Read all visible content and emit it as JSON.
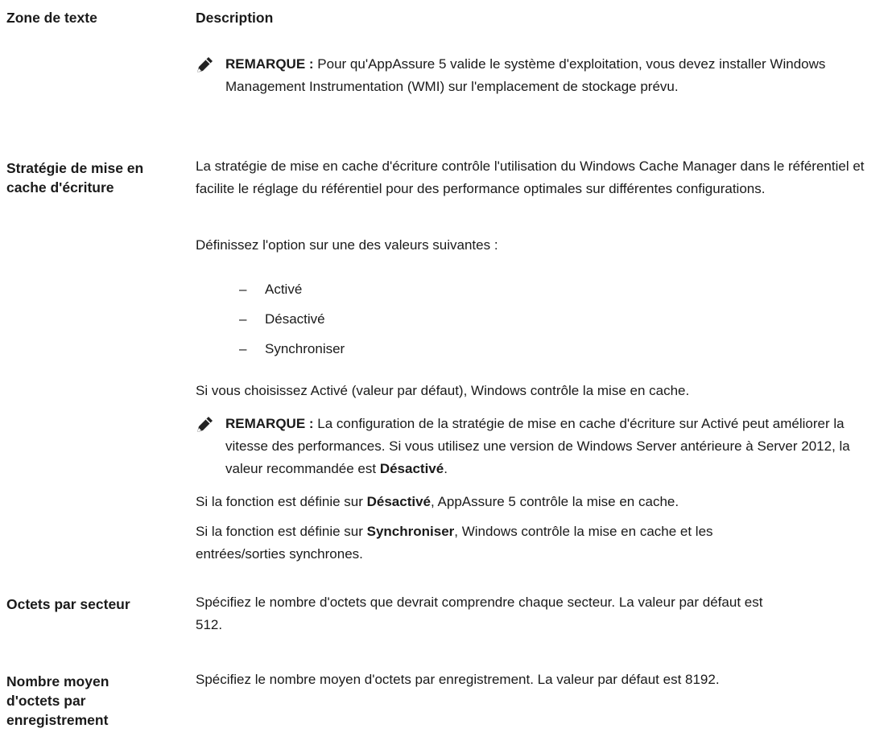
{
  "header": {
    "col1": "Zone de texte",
    "col2": "Description"
  },
  "note1": {
    "label": "REMARQUE :",
    "text": " Pour qu'AppAssure 5 valide le système d'exploitation, vous devez installer Windows Management Instrumentation (WMI) sur l'emplacement de stockage prévu."
  },
  "row1": {
    "term": "Stratégie de mise en cache d'écriture",
    "p1": "La stratégie de mise en cache d'écriture contrôle l'utilisation du Windows Cache Manager dans le référentiel et facilite le réglage du référentiel pour des performance optimales sur différentes configurations.",
    "p2": "Définissez l'option sur une des valeurs suivantes :",
    "options": [
      "Activé",
      "Désactivé",
      "Synchroniser"
    ],
    "p3": "Si vous choisissez Activé (valeur par défaut), Windows contrôle la mise en cache.",
    "note_label": "REMARQUE :",
    "note_text": " La configuration de la stratégie de mise en cache d'écriture sur Activé peut améliorer la vitesse des performances. Si vous utilisez une version de Windows Server antérieure à Server 2012, la valeur recommandée est ",
    "note_bold": "Désactivé",
    "note_end": ".",
    "p4_pre": "Si la fonction est définie sur ",
    "p4_bold": "Désactivé",
    "p4_post": ", AppAssure 5 contrôle la mise en cache.",
    "p5_pre": "Si la fonction est définie sur ",
    "p5_bold": "Synchroniser",
    "p5_post": ", Windows contrôle la mise en cache et les entrées/sorties synchrones."
  },
  "row2": {
    "term": "Octets par secteur",
    "desc": "Spécifiez le nombre d'octets que devrait comprendre chaque secteur. La valeur par défaut est 512."
  },
  "row3": {
    "term": "Nombre moyen d'octets par enregistrement",
    "desc": "Spécifiez le nombre moyen d'octets par enregistrement. La valeur par défaut est 8192."
  },
  "icons": {
    "note": "pencil-note-icon"
  }
}
